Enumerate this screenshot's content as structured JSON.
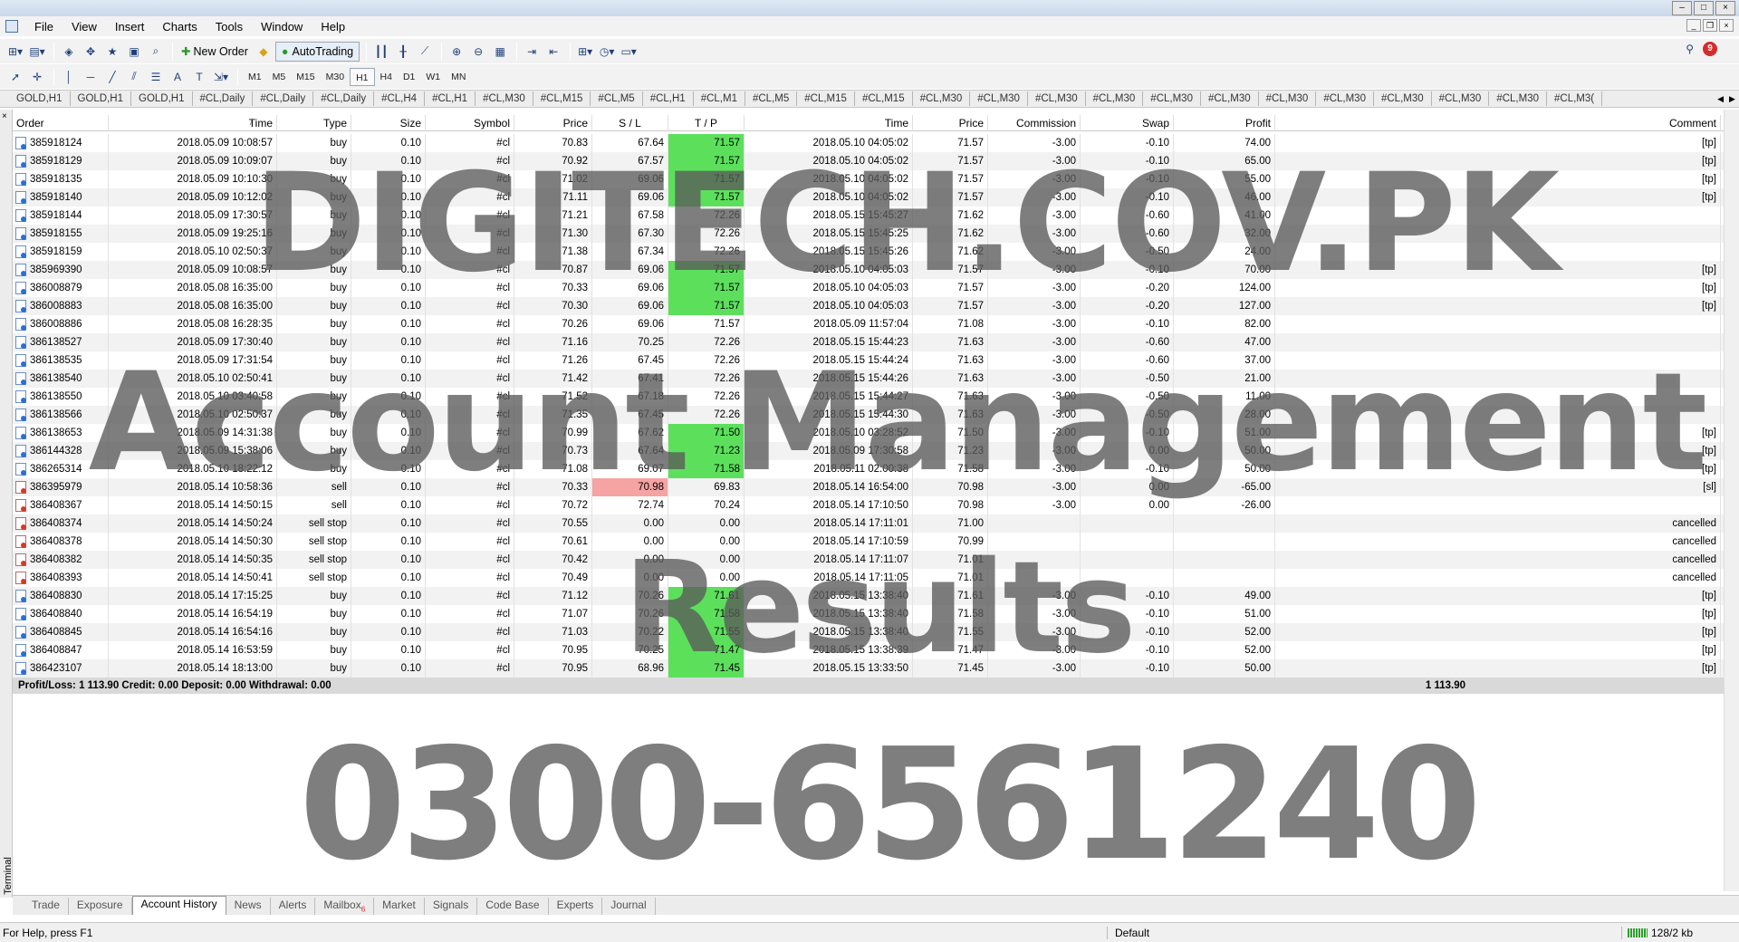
{
  "menu": {
    "items": [
      "File",
      "View",
      "Insert",
      "Charts",
      "Tools",
      "Window",
      "Help"
    ]
  },
  "toolbar": {
    "new_order": "New Order",
    "autotrading": "AutoTrading",
    "timeframes": [
      "M1",
      "M5",
      "M15",
      "M30",
      "H1",
      "H4",
      "D1",
      "W1",
      "MN"
    ],
    "active_timeframe": "H1",
    "alerts_badge": "9"
  },
  "chart_tabs": [
    "GOLD,H1",
    "GOLD,H1",
    "GOLD,H1",
    "#CL,Daily",
    "#CL,Daily",
    "#CL,Daily",
    "#CL,H4",
    "#CL,H1",
    "#CL,M30",
    "#CL,M15",
    "#CL,M5",
    "#CL,H1",
    "#CL,M1",
    "#CL,M5",
    "#CL,M15",
    "#CL,M15",
    "#CL,M30",
    "#CL,M30",
    "#CL,M30",
    "#CL,M30",
    "#CL,M30",
    "#CL,M30",
    "#CL,M30",
    "#CL,M30",
    "#CL,M30",
    "#CL,M30",
    "#CL,M30",
    "#CL,M3("
  ],
  "table": {
    "columns": [
      "Order",
      "Time",
      "Type",
      "Size",
      "Symbol",
      "Price",
      "S / L",
      "T / P",
      "Time",
      "Price",
      "Commission",
      "Swap",
      "Profit",
      "Comment"
    ],
    "sort_indicator": "/",
    "rows": [
      {
        "order": "385918124",
        "time": "2018.05.09 10:08:57",
        "type": "buy",
        "size": "0.10",
        "symbol": "#cl",
        "price": "70.83",
        "sl": "67.64",
        "tp": "71.57",
        "ctime": "2018.05.10 04:05:02",
        "cprice": "71.57",
        "comm": "-3.00",
        "swap": "-0.10",
        "profit": "74.00",
        "comment": "[tp]",
        "hl": "tp"
      },
      {
        "order": "385918129",
        "time": "2018.05.09 10:09:07",
        "type": "buy",
        "size": "0.10",
        "symbol": "#cl",
        "price": "70.92",
        "sl": "67.57",
        "tp": "71.57",
        "ctime": "2018.05.10 04:05:02",
        "cprice": "71.57",
        "comm": "-3.00",
        "swap": "-0.10",
        "profit": "65.00",
        "comment": "[tp]",
        "hl": "tp"
      },
      {
        "order": "385918135",
        "time": "2018.05.09 10:10:30",
        "type": "buy",
        "size": "0.10",
        "symbol": "#cl",
        "price": "71.02",
        "sl": "69.06",
        "tp": "71.57",
        "ctime": "2018.05.10 04:05:02",
        "cprice": "71.57",
        "comm": "-3.00",
        "swap": "-0.10",
        "profit": "55.00",
        "comment": "[tp]",
        "hl": "tp"
      },
      {
        "order": "385918140",
        "time": "2018.05.09 10:12:02",
        "type": "buy",
        "size": "0.10",
        "symbol": "#cl",
        "price": "71.11",
        "sl": "69.06",
        "tp": "71.57",
        "ctime": "2018.05.10 04:05:02",
        "cprice": "71.57",
        "comm": "-3.00",
        "swap": "-0.10",
        "profit": "46.00",
        "comment": "[tp]",
        "hl": "tp"
      },
      {
        "order": "385918144",
        "time": "2018.05.09 17:30:57",
        "type": "buy",
        "size": "0.10",
        "symbol": "#cl",
        "price": "71.21",
        "sl": "67.58",
        "tp": "72.26",
        "ctime": "2018.05.15 15:45:27",
        "cprice": "71.62",
        "comm": "-3.00",
        "swap": "-0.60",
        "profit": "41.00",
        "comment": "",
        "hl": ""
      },
      {
        "order": "385918155",
        "time": "2018.05.09 19:25:16",
        "type": "buy",
        "size": "0.10",
        "symbol": "#cl",
        "price": "71.30",
        "sl": "67.30",
        "tp": "72.26",
        "ctime": "2018.05.15 15:45:25",
        "cprice": "71.62",
        "comm": "-3.00",
        "swap": "-0.60",
        "profit": "32.00",
        "comment": "",
        "hl": ""
      },
      {
        "order": "385918159",
        "time": "2018.05.10 02:50:37",
        "type": "buy",
        "size": "0.10",
        "symbol": "#cl",
        "price": "71.38",
        "sl": "67.34",
        "tp": "72.26",
        "ctime": "2018.05.15 15:45:26",
        "cprice": "71.62",
        "comm": "-3.00",
        "swap": "-0.50",
        "profit": "24.00",
        "comment": "",
        "hl": ""
      },
      {
        "order": "385969390",
        "time": "2018.05.09 10:08:57",
        "type": "buy",
        "size": "0.10",
        "symbol": "#cl",
        "price": "70.87",
        "sl": "69.06",
        "tp": "71.57",
        "ctime": "2018.05.10 04:05:03",
        "cprice": "71.57",
        "comm": "-3.00",
        "swap": "-0.10",
        "profit": "70.00",
        "comment": "[tp]",
        "hl": "tp"
      },
      {
        "order": "386008879",
        "time": "2018.05.08 16:35:00",
        "type": "buy",
        "size": "0.10",
        "symbol": "#cl",
        "price": "70.33",
        "sl": "69.06",
        "tp": "71.57",
        "ctime": "2018.05.10 04:05:03",
        "cprice": "71.57",
        "comm": "-3.00",
        "swap": "-0.20",
        "profit": "124.00",
        "comment": "[tp]",
        "hl": "tp"
      },
      {
        "order": "386008883",
        "time": "2018.05.08 16:35:00",
        "type": "buy",
        "size": "0.10",
        "symbol": "#cl",
        "price": "70.30",
        "sl": "69.06",
        "tp": "71.57",
        "ctime": "2018.05.10 04:05:03",
        "cprice": "71.57",
        "comm": "-3.00",
        "swap": "-0.20",
        "profit": "127.00",
        "comment": "[tp]",
        "hl": "tp"
      },
      {
        "order": "386008886",
        "time": "2018.05.08 16:28:35",
        "type": "buy",
        "size": "0.10",
        "symbol": "#cl",
        "price": "70.26",
        "sl": "69.06",
        "tp": "71.57",
        "ctime": "2018.05.09 11:57:04",
        "cprice": "71.08",
        "comm": "-3.00",
        "swap": "-0.10",
        "profit": "82.00",
        "comment": "",
        "hl": ""
      },
      {
        "order": "386138527",
        "time": "2018.05.09 17:30:40",
        "type": "buy",
        "size": "0.10",
        "symbol": "#cl",
        "price": "71.16",
        "sl": "70.25",
        "tp": "72.26",
        "ctime": "2018.05.15 15:44:23",
        "cprice": "71.63",
        "comm": "-3.00",
        "swap": "-0.60",
        "profit": "47.00",
        "comment": "",
        "hl": ""
      },
      {
        "order": "386138535",
        "time": "2018.05.09 17:31:54",
        "type": "buy",
        "size": "0.10",
        "symbol": "#cl",
        "price": "71.26",
        "sl": "67.45",
        "tp": "72.26",
        "ctime": "2018.05.15 15:44:24",
        "cprice": "71.63",
        "comm": "-3.00",
        "swap": "-0.60",
        "profit": "37.00",
        "comment": "",
        "hl": ""
      },
      {
        "order": "386138540",
        "time": "2018.05.10 02:50:41",
        "type": "buy",
        "size": "0.10",
        "symbol": "#cl",
        "price": "71.42",
        "sl": "67.41",
        "tp": "72.26",
        "ctime": "2018.05.15 15:44:26",
        "cprice": "71.63",
        "comm": "-3.00",
        "swap": "-0.50",
        "profit": "21.00",
        "comment": "",
        "hl": ""
      },
      {
        "order": "386138550",
        "time": "2018.05.10 03:40:58",
        "type": "buy",
        "size": "0.10",
        "symbol": "#cl",
        "price": "71.52",
        "sl": "67.18",
        "tp": "72.26",
        "ctime": "2018.05.15 15:44:27",
        "cprice": "71.63",
        "comm": "-3.00",
        "swap": "-0.50",
        "profit": "11.00",
        "comment": "",
        "hl": ""
      },
      {
        "order": "386138566",
        "time": "2018.05.10 02:50:37",
        "type": "buy",
        "size": "0.10",
        "symbol": "#cl",
        "price": "71.35",
        "sl": "67.45",
        "tp": "72.26",
        "ctime": "2018.05.15 15:44:30",
        "cprice": "71.63",
        "comm": "-3.00",
        "swap": "-0.50",
        "profit": "28.00",
        "comment": "",
        "hl": ""
      },
      {
        "order": "386138653",
        "time": "2018.05.09 14:31:38",
        "type": "buy",
        "size": "0.10",
        "symbol": "#cl",
        "price": "70.99",
        "sl": "67.62",
        "tp": "71.50",
        "ctime": "2018.05.10 03:28:52",
        "cprice": "71.50",
        "comm": "-3.00",
        "swap": "-0.10",
        "profit": "51.00",
        "comment": "[tp]",
        "hl": "tp"
      },
      {
        "order": "386144328",
        "time": "2018.05.09 15:38:06",
        "type": "buy",
        "size": "0.10",
        "symbol": "#cl",
        "price": "70.73",
        "sl": "67.64",
        "tp": "71.23",
        "ctime": "2018.05.09 17:30:58",
        "cprice": "71.23",
        "comm": "-3.00",
        "swap": "0.00",
        "profit": "50.00",
        "comment": "[tp]",
        "hl": "tp"
      },
      {
        "order": "386265314",
        "time": "2018.05.10 18:22:12",
        "type": "buy",
        "size": "0.10",
        "symbol": "#cl",
        "price": "71.08",
        "sl": "69.07",
        "tp": "71.58",
        "ctime": "2018.05.11 02:00:38",
        "cprice": "71.58",
        "comm": "-3.00",
        "swap": "-0.10",
        "profit": "50.00",
        "comment": "[tp]",
        "hl": "tp"
      },
      {
        "order": "386395979",
        "time": "2018.05.14 10:58:36",
        "type": "sell",
        "size": "0.10",
        "symbol": "#cl",
        "price": "70.33",
        "sl": "70.98",
        "tp": "69.83",
        "ctime": "2018.05.14 16:54:00",
        "cprice": "70.98",
        "comm": "-3.00",
        "swap": "0.00",
        "profit": "-65.00",
        "comment": "[sl]",
        "hl": "sl"
      },
      {
        "order": "386408367",
        "time": "2018.05.14 14:50:15",
        "type": "sell",
        "size": "0.10",
        "symbol": "#cl",
        "price": "70.72",
        "sl": "72.74",
        "tp": "70.24",
        "ctime": "2018.05.14 17:10:50",
        "cprice": "70.98",
        "comm": "-3.00",
        "swap": "0.00",
        "profit": "-26.00",
        "comment": "",
        "hl": ""
      },
      {
        "order": "386408374",
        "time": "2018.05.14 14:50:24",
        "type": "sell stop",
        "size": "0.10",
        "symbol": "#cl",
        "price": "70.55",
        "sl": "0.00",
        "tp": "0.00",
        "ctime": "2018.05.14 17:11:01",
        "cprice": "71.00",
        "comm": "",
        "swap": "",
        "profit": "",
        "comment": "cancelled",
        "hl": ""
      },
      {
        "order": "386408378",
        "time": "2018.05.14 14:50:30",
        "type": "sell stop",
        "size": "0.10",
        "symbol": "#cl",
        "price": "70.61",
        "sl": "0.00",
        "tp": "0.00",
        "ctime": "2018.05.14 17:10:59",
        "cprice": "70.99",
        "comm": "",
        "swap": "",
        "profit": "",
        "comment": "cancelled",
        "hl": ""
      },
      {
        "order": "386408382",
        "time": "2018.05.14 14:50:35",
        "type": "sell stop",
        "size": "0.10",
        "symbol": "#cl",
        "price": "70.42",
        "sl": "0.00",
        "tp": "0.00",
        "ctime": "2018.05.14 17:11:07",
        "cprice": "71.01",
        "comm": "",
        "swap": "",
        "profit": "",
        "comment": "cancelled",
        "hl": ""
      },
      {
        "order": "386408393",
        "time": "2018.05.14 14:50:41",
        "type": "sell stop",
        "size": "0.10",
        "symbol": "#cl",
        "price": "70.49",
        "sl": "0.00",
        "tp": "0.00",
        "ctime": "2018.05.14 17:11:05",
        "cprice": "71.01",
        "comm": "",
        "swap": "",
        "profit": "",
        "comment": "cancelled",
        "hl": ""
      },
      {
        "order": "386408830",
        "time": "2018.05.14 17:15:25",
        "type": "buy",
        "size": "0.10",
        "symbol": "#cl",
        "price": "71.12",
        "sl": "70.26",
        "tp": "71.61",
        "ctime": "2018.05.15 13:38:40",
        "cprice": "71.61",
        "comm": "-3.00",
        "swap": "-0.10",
        "profit": "49.00",
        "comment": "[tp]",
        "hl": "tp"
      },
      {
        "order": "386408840",
        "time": "2018.05.14 16:54:19",
        "type": "buy",
        "size": "0.10",
        "symbol": "#cl",
        "price": "71.07",
        "sl": "70.26",
        "tp": "71.58",
        "ctime": "2018.05.15 13:38:40",
        "cprice": "71.58",
        "comm": "-3.00",
        "swap": "-0.10",
        "profit": "51.00",
        "comment": "[tp]",
        "hl": "tp"
      },
      {
        "order": "386408845",
        "time": "2018.05.14 16:54:16",
        "type": "buy",
        "size": "0.10",
        "symbol": "#cl",
        "price": "71.03",
        "sl": "70.22",
        "tp": "71.55",
        "ctime": "2018.05.15 13:38:40",
        "cprice": "71.55",
        "comm": "-3.00",
        "swap": "-0.10",
        "profit": "52.00",
        "comment": "[tp]",
        "hl": "tp"
      },
      {
        "order": "386408847",
        "time": "2018.05.14 16:53:59",
        "type": "buy",
        "size": "0.10",
        "symbol": "#cl",
        "price": "70.95",
        "sl": "70.25",
        "tp": "71.47",
        "ctime": "2018.05.15 13:38:39",
        "cprice": "71.47",
        "comm": "-3.00",
        "swap": "-0.10",
        "profit": "52.00",
        "comment": "[tp]",
        "hl": "tp"
      },
      {
        "order": "386423107",
        "time": "2018.05.14 18:13:00",
        "type": "buy",
        "size": "0.10",
        "symbol": "#cl",
        "price": "70.95",
        "sl": "68.96",
        "tp": "71.45",
        "ctime": "2018.05.15 13:33:50",
        "cprice": "71.45",
        "comm": "-3.00",
        "swap": "-0.10",
        "profit": "50.00",
        "comment": "[tp]",
        "hl": "tp"
      }
    ],
    "summary_label": "Profit/Loss: 1 113.90  Credit: 0.00  Deposit: 0.00  Withdrawal: 0.00",
    "summary_total": "1 113.90"
  },
  "watermark": {
    "line1": "DIGITECH.COV.PK",
    "line2": "Account Management",
    "line3": "Results",
    "line4": "0300-6561240"
  },
  "terminal": {
    "side_label": "Terminal",
    "close": "×",
    "tabs": [
      "Trade",
      "Exposure",
      "Account History",
      "News",
      "Alerts",
      "Mailbox",
      "Market",
      "Signals",
      "Code Base",
      "Experts",
      "Journal"
    ],
    "active_tab": "Account History",
    "mailbox_count": "6"
  },
  "status": {
    "help": "For Help, press F1",
    "profile": "Default",
    "traffic": "128/2 kb"
  },
  "colors": {
    "tp_highlight": "#5ce05c",
    "sl_highlight": "#f5a3a3"
  }
}
